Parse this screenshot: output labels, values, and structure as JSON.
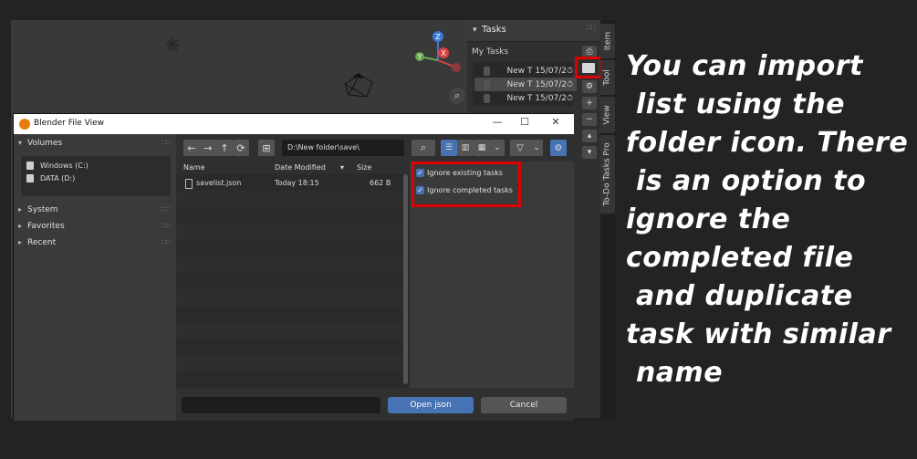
{
  "viewport": {
    "gizmo": {
      "z": "Z",
      "x": "X",
      "y": "Y"
    },
    "icons": [
      "sun-light-icon",
      "camera-icon",
      "zoom-icon"
    ]
  },
  "tasks_panel": {
    "title": "Tasks",
    "list_label": "My Tasks",
    "tasks": [
      {
        "label": "New T  15/07/2",
        "selected": false
      },
      {
        "label": "New T  15/07/2",
        "selected": true
      },
      {
        "label": "New T  15/07/2",
        "selected": false
      }
    ],
    "side_buttons": [
      "+",
      "−"
    ],
    "highlight_color": "#e00000"
  },
  "vertical_tabs": [
    "Item",
    "Tool",
    "View",
    "To-Do Tasks Pro"
  ],
  "file_dialog": {
    "title": "Blender File View",
    "window_buttons": [
      "—",
      "☐",
      "✕"
    ],
    "sidebar": {
      "volumes": {
        "label": "Volumes",
        "items": [
          "Windows (C:)",
          "DATA (D:)"
        ]
      },
      "sections": [
        "System",
        "Favorites",
        "Recent"
      ]
    },
    "toolbar": {
      "buttons": [
        "←",
        "→",
        "↑",
        "⟳"
      ],
      "path": "D:\\New folder\\save\\"
    },
    "columns": {
      "name": "Name",
      "date": "Date Modified",
      "size": "Size"
    },
    "files": [
      {
        "name": "savelist.json",
        "date": "Today 18:15",
        "size": "662 B"
      }
    ],
    "options": {
      "ignore_existing": "Ignore existing tasks",
      "ignore_completed": "Ignore completed tasks"
    },
    "open_label": "Open json",
    "cancel_label": "Cancel",
    "accent": "#4772b3"
  },
  "caption": [
    "You can import",
    " list using the",
    "folder icon. There",
    " is an option to",
    "ignore the",
    "completed file",
    " and duplicate",
    "task with similar",
    " name"
  ]
}
